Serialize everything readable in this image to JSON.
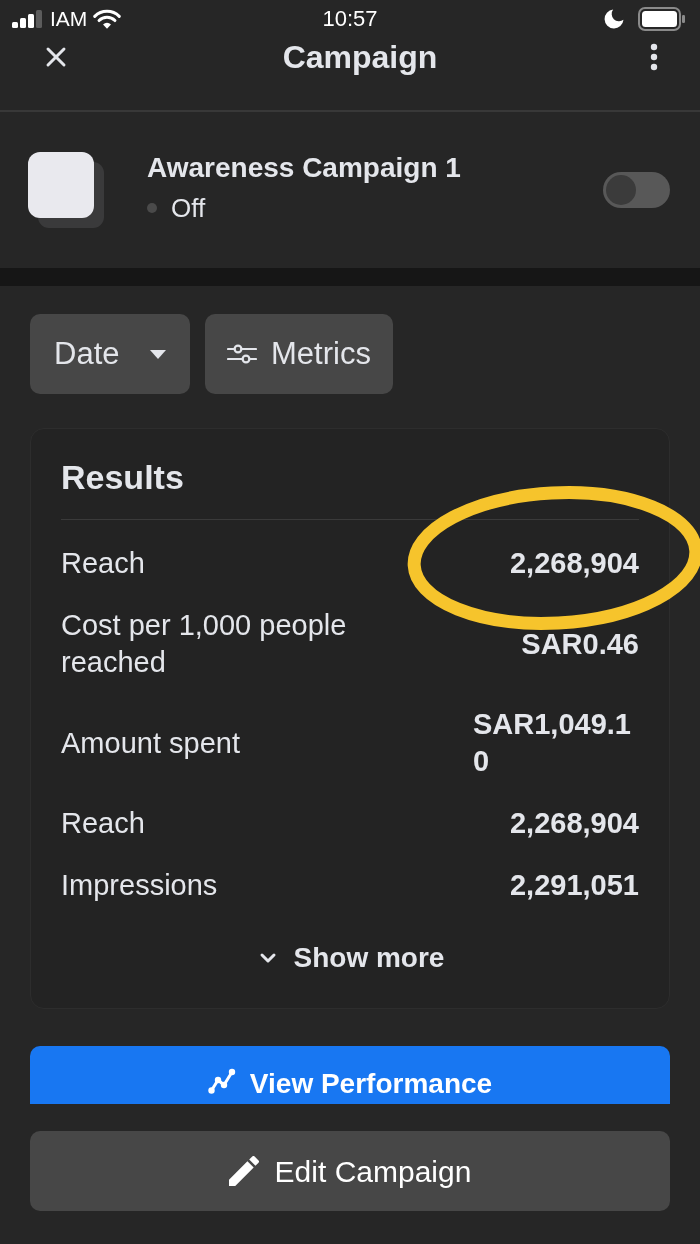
{
  "status_bar": {
    "carrier": "IAM",
    "time": "10:57"
  },
  "header": {
    "title": "Campaign"
  },
  "campaign": {
    "name": "Awareness Campaign 1",
    "status": "Off",
    "on": false
  },
  "filters": [
    {
      "kind": "dropdown",
      "label": "Date"
    },
    {
      "kind": "settings",
      "label": "Metrics"
    }
  ],
  "results": {
    "title": "Results",
    "rows": [
      {
        "label": "Reach",
        "value": "2,268,904",
        "highlighted": true
      },
      {
        "label": "Cost per 1,000 people reached",
        "value": "SAR0.46",
        "highlighted": false
      },
      {
        "label": "Amount spent",
        "value": "SAR1,049.10",
        "highlighted": false
      },
      {
        "label": "Reach",
        "value": "2,268,904",
        "highlighted": false
      },
      {
        "label": "Impressions",
        "value": "2,291,051",
        "highlighted": false
      }
    ],
    "show_more": "Show more"
  },
  "buttons": [
    {
      "kind": "primary",
      "label": "View Performance"
    },
    {
      "kind": "secondary",
      "label": "Edit Campaign"
    }
  ]
}
